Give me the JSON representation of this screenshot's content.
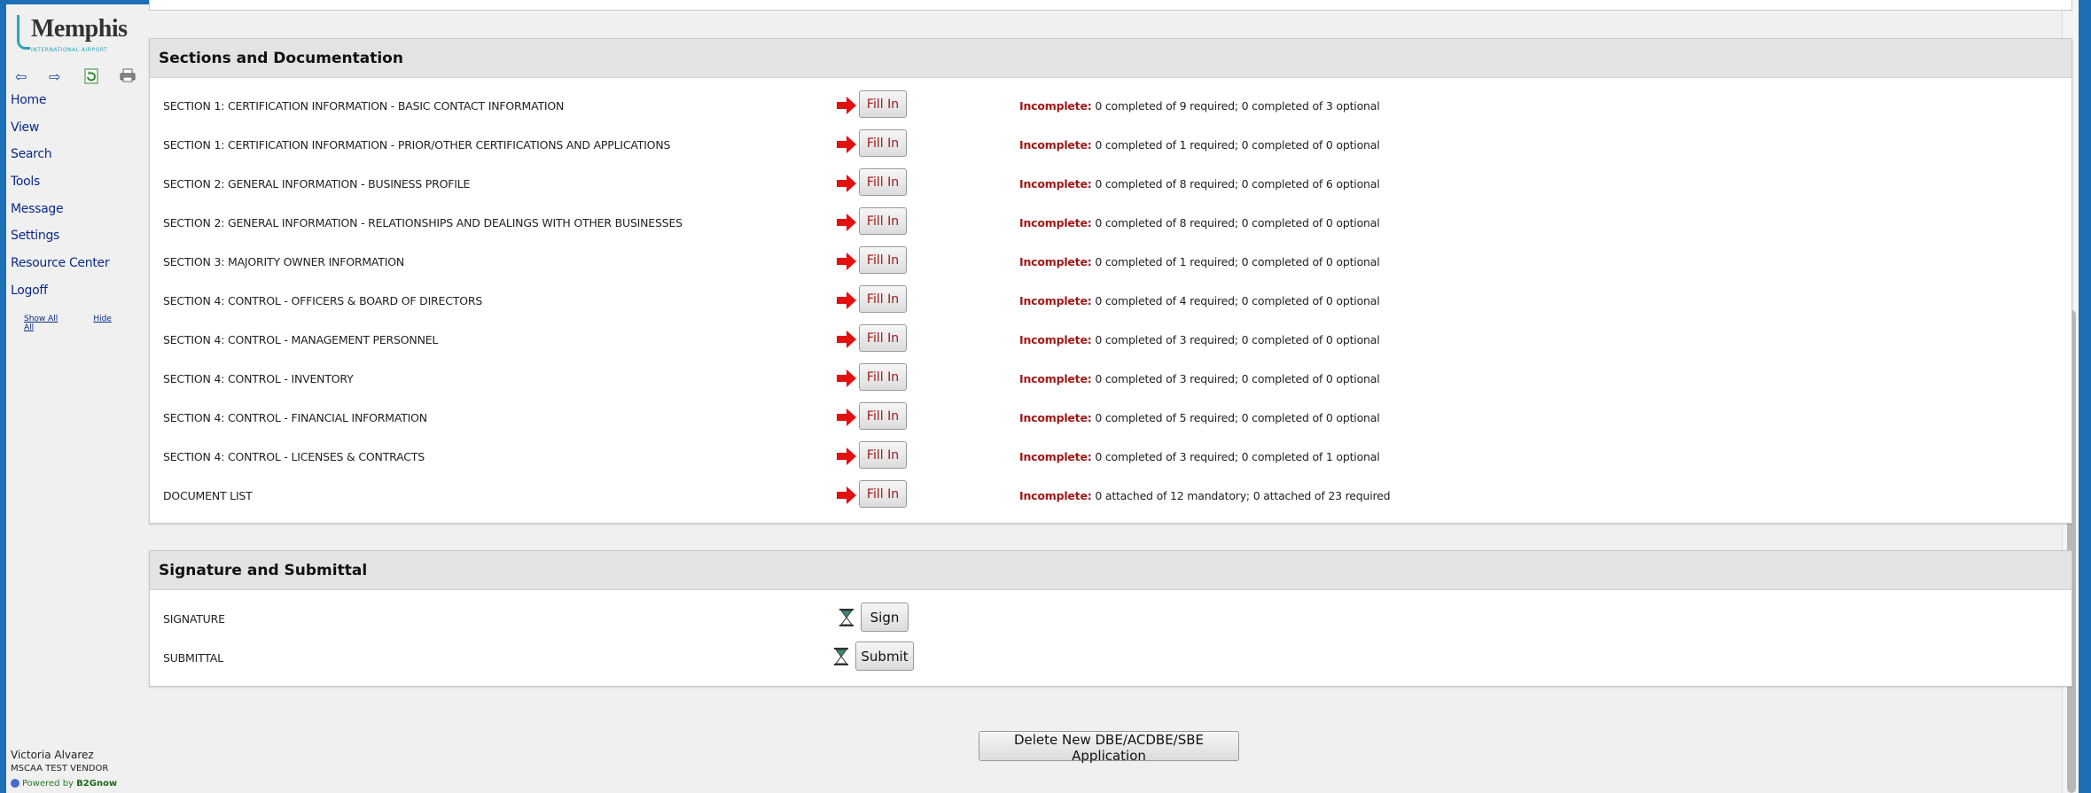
{
  "brand": {
    "name": "Memphis",
    "subtitle": "INTERNATIONAL AIRPORT"
  },
  "toolbar": {
    "icons": [
      "back-arrow-icon",
      "forward-arrow-icon",
      "refresh-icon",
      "print-icon"
    ]
  },
  "nav": {
    "items": [
      "Home",
      "View",
      "Search",
      "Tools",
      "Message",
      "Settings",
      "Resource Center",
      "Logoff"
    ],
    "show_all": "Show All",
    "hide_all": "Hide All"
  },
  "user": {
    "name": "Victoria Alvarez",
    "org": "MSCAA TEST VENDOR",
    "powered_prefix": "Powered by",
    "powered_brand": "B2Gnow"
  },
  "sections": {
    "title": "Sections and Documentation",
    "fill_label": "Fill In",
    "incomplete_label": "Incomplete:",
    "rows": [
      {
        "label": "SECTION 1: CERTIFICATION INFORMATION - BASIC CONTACT INFORMATION",
        "status": "0 completed of 9 required; 0 completed of 3 optional"
      },
      {
        "label": "SECTION 1: CERTIFICATION INFORMATION - PRIOR/OTHER CERTIFICATIONS AND APPLICATIONS",
        "status": "0 completed of 1 required; 0 completed of 0 optional"
      },
      {
        "label": "SECTION 2: GENERAL INFORMATION - BUSINESS PROFILE",
        "status": "0 completed of 8 required; 0 completed of 6 optional"
      },
      {
        "label": "SECTION 2: GENERAL INFORMATION - RELATIONSHIPS AND DEALINGS WITH OTHER BUSINESSES",
        "status": "0 completed of 8 required; 0 completed of 0 optional"
      },
      {
        "label": "SECTION 3: MAJORITY OWNER INFORMATION",
        "status": "0 completed of 1 required; 0 completed of 0 optional"
      },
      {
        "label": "SECTION 4: CONTROL - OFFICERS & BOARD OF DIRECTORS",
        "status": "0 completed of 4 required; 0 completed of 0 optional"
      },
      {
        "label": "SECTION 4: CONTROL - MANAGEMENT PERSONNEL",
        "status": "0 completed of 3 required; 0 completed of 0 optional"
      },
      {
        "label": "SECTION 4: CONTROL - INVENTORY",
        "status": "0 completed of 3 required; 0 completed of 0 optional"
      },
      {
        "label": "SECTION 4: CONTROL - FINANCIAL INFORMATION",
        "status": "0 completed of 5 required; 0 completed of 0 optional"
      },
      {
        "label": "SECTION 4: CONTROL - LICENSES & CONTRACTS",
        "status": "0 completed of 3 required; 0 completed of 1 optional"
      },
      {
        "label": "DOCUMENT LIST",
        "status": "0 attached of 12 mandatory; 0 attached of 23 required"
      }
    ]
  },
  "signature": {
    "title": "Signature and Submittal",
    "signature_label": "SIGNATURE",
    "sign_button": "Sign",
    "submittal_label": "SUBMITTAL",
    "submit_button": "Submit"
  },
  "delete_button": "Delete New DBE/ACDBE/SBE Application"
}
